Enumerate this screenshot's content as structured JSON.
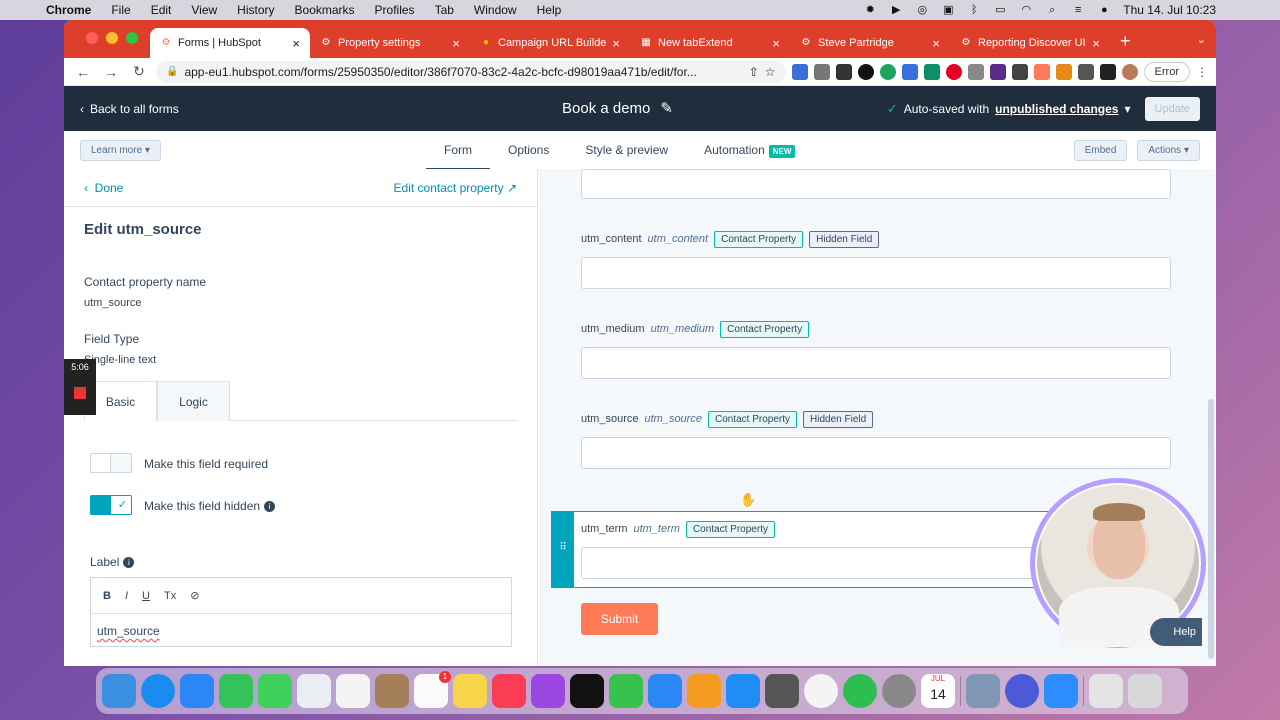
{
  "menubar": {
    "app": "Chrome",
    "items": [
      "File",
      "Edit",
      "View",
      "History",
      "Bookmarks",
      "Profiles",
      "Tab",
      "Window",
      "Help"
    ],
    "clock": "Thu 14. Jul  10:23"
  },
  "tabs": [
    {
      "title": "Forms | HubSpot",
      "icon": "hubspot-icon",
      "color": "#ff7a59"
    },
    {
      "title": "Property settings",
      "icon": "hubspot-icon",
      "color": "#ff7a59"
    },
    {
      "title": "Campaign URL Builder",
      "icon": "google-icon",
      "color": "#fbbc05"
    },
    {
      "title": "New tabExtend",
      "icon": "tabextend-icon",
      "color": "#2a6cdf"
    },
    {
      "title": "Steve Partridge",
      "icon": "hubspot-icon",
      "color": "#ff7a59"
    },
    {
      "title": "Reporting Discover UI",
      "icon": "hubspot-icon",
      "color": "#ff7a59"
    }
  ],
  "address": "app-eu1.hubspot.com/forms/25950350/editor/386f7070-83c2-4a2c-bcfc-d98019aa471b/edit/for...",
  "error_label": "Error",
  "header": {
    "back": "Back to all forms",
    "title": "Book a demo",
    "saved_prefix": "Auto-saved with ",
    "saved_link": "unpublished changes",
    "update": "Update"
  },
  "subnav": {
    "learn": "Learn more",
    "tabs": [
      "Form",
      "Options",
      "Style & preview",
      "Automation"
    ],
    "new_badge": "NEW",
    "embed": "Embed",
    "actions": "Actions"
  },
  "left": {
    "done": "Done",
    "edit_contact": "Edit contact property",
    "title": "Edit utm_source",
    "recorder_time": "5:06",
    "cp_label": "Contact property name",
    "cp_value": "utm_source",
    "ft_label": "Field Type",
    "ft_value": "Single-line text",
    "tab_basic": "Basic",
    "tab_logic": "Logic",
    "required": "Make this field required",
    "hidden": "Make this field hidden",
    "label": "Label",
    "rte_buttons": [
      "B",
      "I",
      "U",
      "Tx",
      "⊘"
    ],
    "label_value": "utm_source"
  },
  "form": {
    "fields": [
      {
        "name": "utm_content",
        "internal": "utm_content",
        "tags": [
          "Contact Property",
          "Hidden Field"
        ]
      },
      {
        "name": "utm_medium",
        "internal": "utm_medium",
        "tags": [
          "Contact Property"
        ]
      },
      {
        "name": "utm_source",
        "internal": "utm_source",
        "tags": [
          "Contact Property",
          "Hidden Field"
        ]
      },
      {
        "name": "utm_term",
        "internal": "utm_term",
        "tags": [
          "Contact Property"
        ]
      }
    ],
    "submit": "Submit",
    "help": "Help"
  },
  "colors": {
    "hubspot_header": "#1f2d3d",
    "chrome_tabstrip": "#de3f2a",
    "accent_teal": "#00a4bd",
    "submit_orange": "#ff7a59"
  }
}
